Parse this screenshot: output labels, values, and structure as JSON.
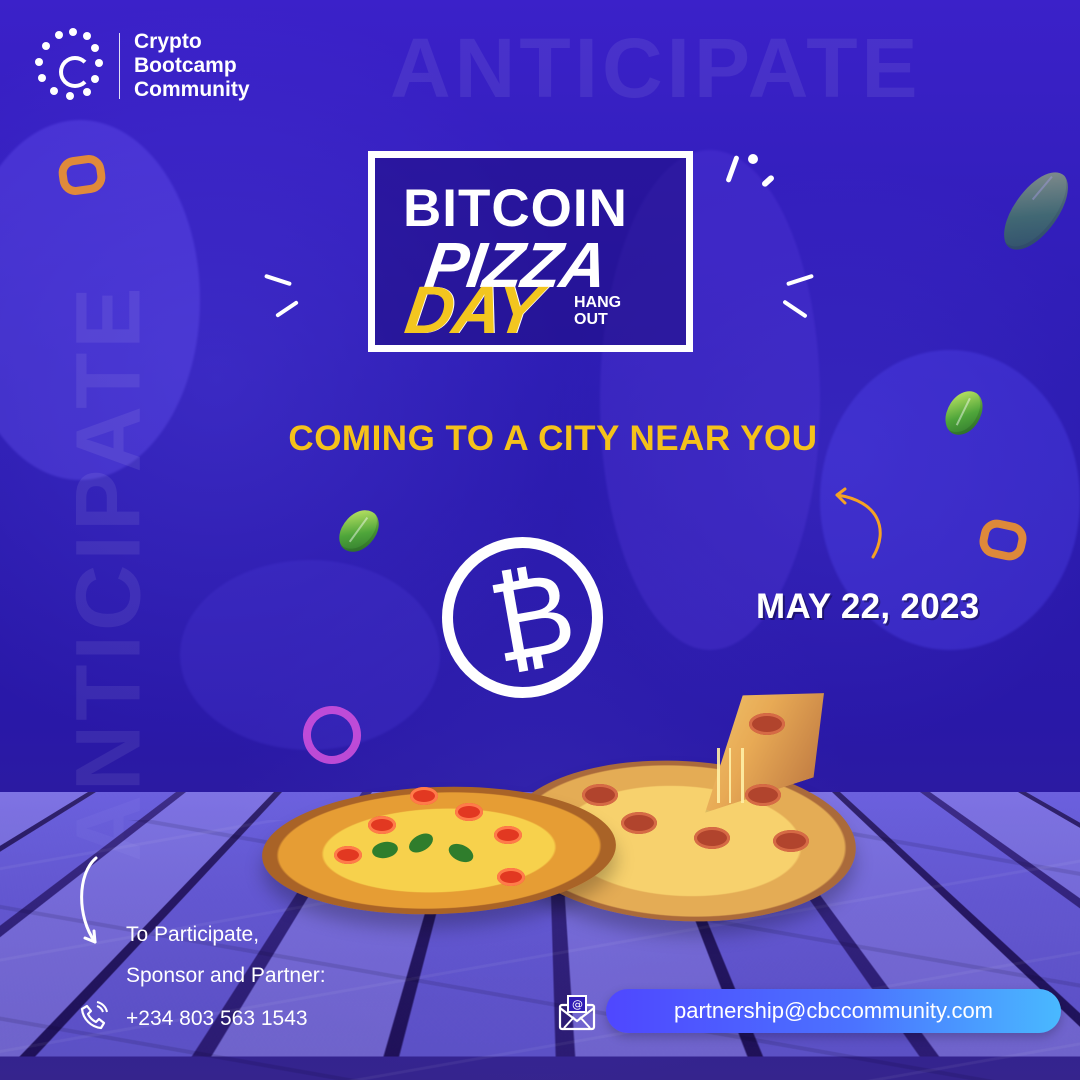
{
  "brand": {
    "line1": "Crypto",
    "line2": "Bootcamp",
    "line3": "Community"
  },
  "background_words": {
    "top": "ANTICIPATE",
    "left": "ANTICIPATE"
  },
  "hero": {
    "bitcoin": "BITCOIN",
    "pizza": "PIZZA",
    "day": "DAY",
    "hang": "HANG",
    "out": "OUT"
  },
  "headline": "COMING TO A CITY NEAR YOU",
  "event_date": "MAY 22, 2023",
  "bitcoin_symbol": "₿",
  "contact": {
    "participate_line1": "To Participate,",
    "participate_line2": "Sponsor and Partner:",
    "phone": "+234 803 563 1543",
    "email": "partnership@cbccommunity.com"
  },
  "icons": {
    "logo": "crypto-bootcamp-logo-icon",
    "bitcoin": "bitcoin-icon",
    "phone": "phone-icon",
    "email": "email-icon",
    "arrow": "curved-arrow-icon"
  },
  "colors": {
    "primary_bg": "#2f1cb6",
    "accent_yellow": "#f5c21a",
    "white": "#ffffff",
    "email_start": "#4f47ff",
    "email_end": "#49b9ff"
  }
}
